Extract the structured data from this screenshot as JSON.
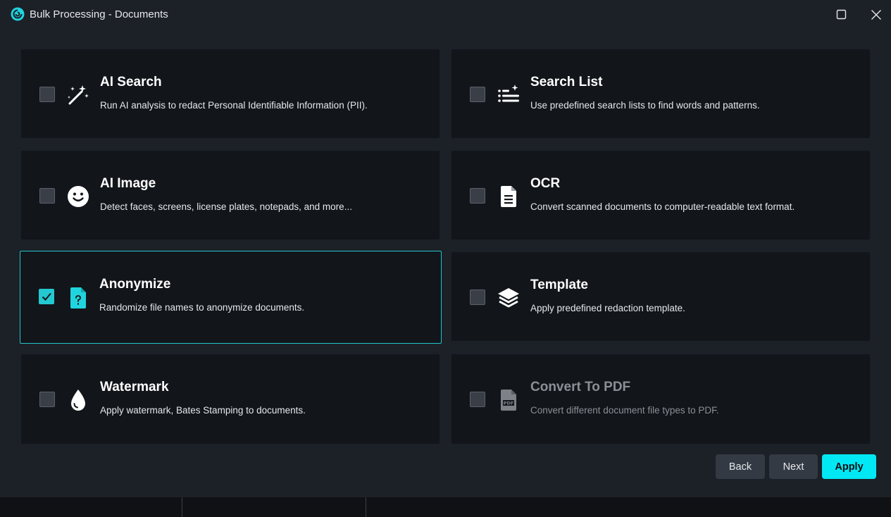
{
  "window": {
    "title": "Bulk Processing - Documents",
    "accent_color": "#00e8f4"
  },
  "options": [
    {
      "title": "AI Search",
      "description": "Run AI analysis to redact Personal Identifiable Information (PII).",
      "icon": "magic-wand-icon",
      "checked": false,
      "disabled": false
    },
    {
      "title": "Search List",
      "description": "Use predefined search lists to find words and patterns.",
      "icon": "search-list-icon",
      "checked": false,
      "disabled": false
    },
    {
      "title": "AI Image",
      "description": "Detect faces, screens, license plates, notepads, and more...",
      "icon": "smiley-face-icon",
      "checked": false,
      "disabled": false
    },
    {
      "title": "OCR",
      "description": "Convert scanned documents to computer-readable text format.",
      "icon": "document-text-icon",
      "checked": false,
      "disabled": false
    },
    {
      "title": "Anonymize",
      "description": "Randomize file names to anonymize documents.",
      "icon": "anonymous-file-icon",
      "checked": true,
      "disabled": false
    },
    {
      "title": "Template",
      "description": "Apply predefined redaction template.",
      "icon": "layers-icon",
      "checked": false,
      "disabled": false
    },
    {
      "title": "Watermark",
      "description": "Apply watermark, Bates Stamping to documents.",
      "icon": "droplet-icon",
      "checked": false,
      "disabled": false
    },
    {
      "title": "Convert To PDF",
      "description": "Convert different document file types to PDF.",
      "icon": "pdf-file-icon",
      "checked": false,
      "disabled": true
    }
  ],
  "buttons": {
    "back": "Back",
    "next": "Next",
    "apply": "Apply"
  }
}
